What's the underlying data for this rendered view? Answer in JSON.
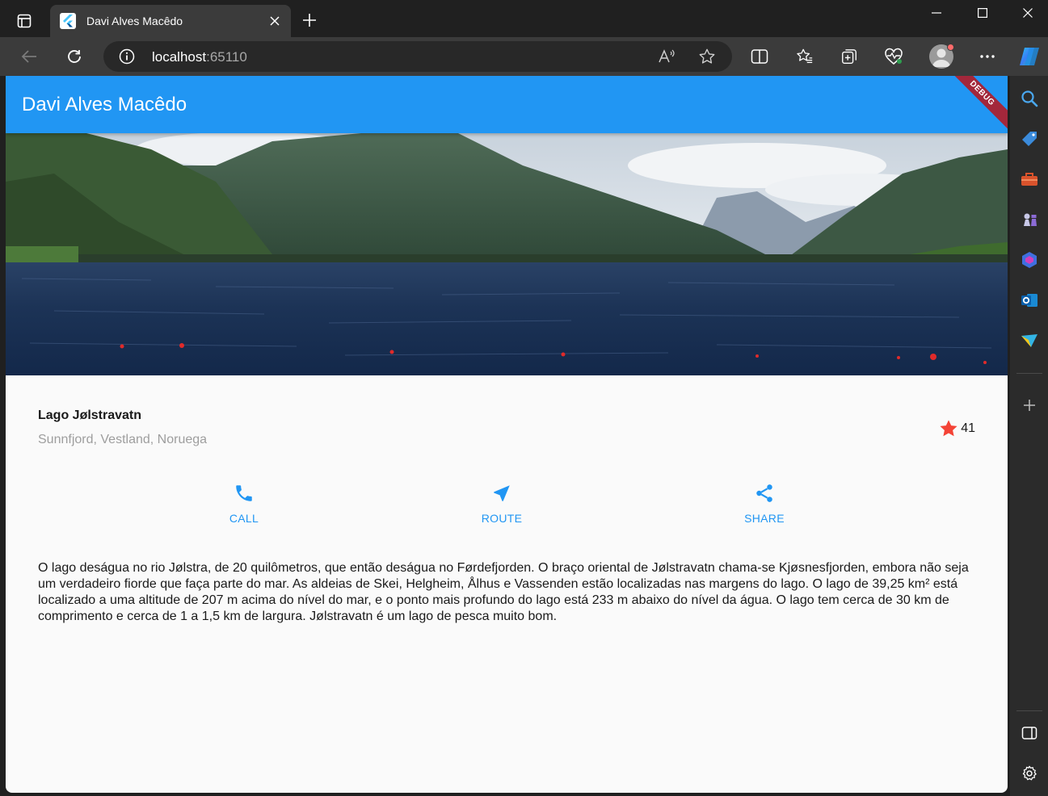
{
  "browser": {
    "tab_title": "Davi Alves Macêdo",
    "url_host": "localhost",
    "url_port": ":65110"
  },
  "app": {
    "appbar_title": "Davi Alves Macêdo",
    "debug_banner": "DEBUG",
    "place": {
      "name": "Lago Jølstravatn",
      "location": "Sunnfjord, Vestland, Noruega",
      "star_count": "41"
    },
    "actions": [
      {
        "label": "CALL",
        "icon": "phone-icon"
      },
      {
        "label": "ROUTE",
        "icon": "navigation-icon"
      },
      {
        "label": "SHARE",
        "icon": "share-icon"
      }
    ],
    "description": "O lago deságua no rio Jølstra, de 20 quilômetros, que então deságua no Førdefjorden. O braço oriental de Jølstravatn chama-se Kjøsnesfjorden, embora não seja um verdadeiro fiorde que faça parte do mar. As aldeias de Skei, Helgheim, Ålhus e Vassenden estão localizadas nas margens do lago. O lago de 39,25 km² está localizado a uma altitude de 207 m acima do nível do mar, e o ponto mais profundo do lago está 233 m abaixo do nível da água. O lago tem cerca de 30 km de comprimento e cerca de 1 a 1,5 km de largura. Jølstravatn é um lago de pesca muito bom."
  },
  "colors": {
    "primary": "#2196f3",
    "star": "#f44336",
    "debug": "#a3273b"
  }
}
